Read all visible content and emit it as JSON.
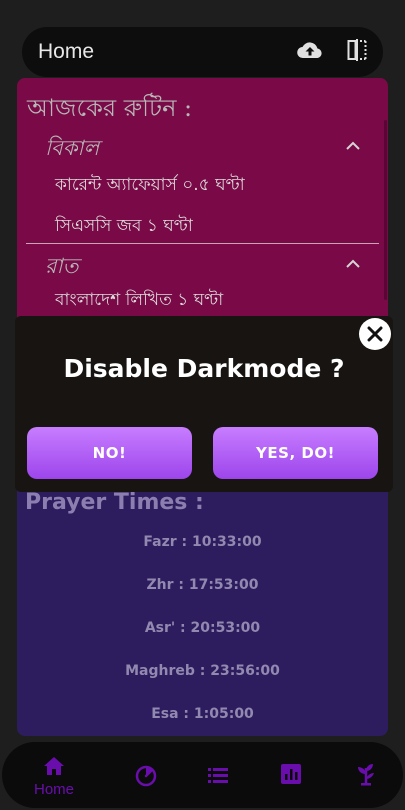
{
  "topbar": {
    "title": "Home",
    "icons": [
      "cloud-upload-icon",
      "split-view-icon"
    ]
  },
  "routine": {
    "heading": "আজকের রুটিন :",
    "sections": [
      {
        "name": "বিকাল",
        "items": [
          "কারেন্ট অ্যাফেয়ার্স ০.৫ ঘণ্টা",
          "সিএসসি জব ১ ঘণ্টা"
        ]
      },
      {
        "name": "রাত",
        "items": [
          "বাংলাদেশ লিখিত ১ ঘণ্টা"
        ]
      }
    ]
  },
  "prayer": {
    "heading": "Prayer Times :",
    "times": [
      "Fazr : 10:33:00",
      "Zhr : 17:53:00",
      "Asr' : 20:53:00",
      "Maghreb : 23:56:00",
      "Esa : 1:05:00"
    ]
  },
  "dialog": {
    "title": "Disable Darkmode ?",
    "no_label": "NO!",
    "yes_label": "YES, DO!"
  },
  "nav": {
    "home_label": "Home",
    "items": [
      "home-icon",
      "timer-icon",
      "list-icon",
      "chart-icon",
      "plant-icon"
    ]
  },
  "colors": {
    "accent": "#6a0dad",
    "routine_bg": "#7a0a47",
    "prayer_bg": "#2e1d5e",
    "button": "#b45cf7"
  }
}
